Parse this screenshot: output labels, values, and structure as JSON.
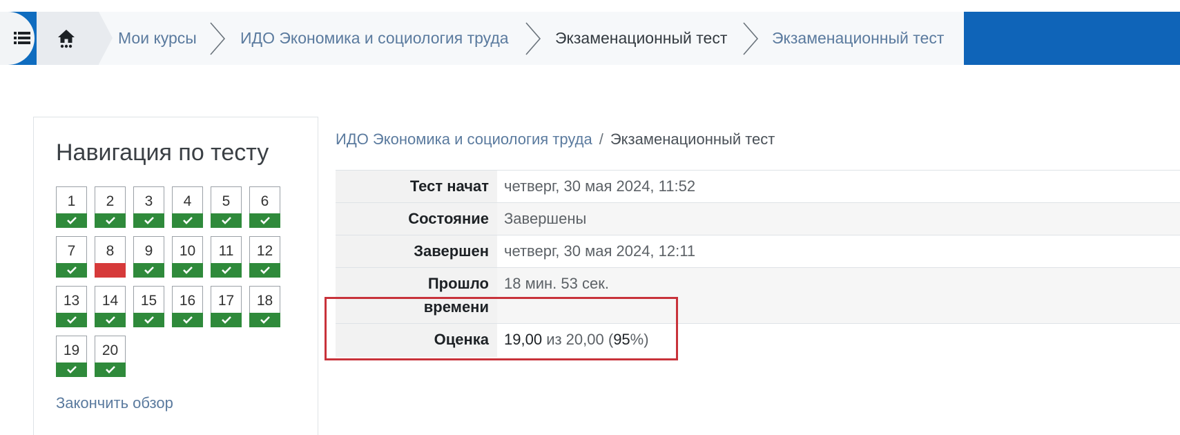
{
  "breadcrumb": {
    "items": [
      {
        "label": "Мои курсы",
        "kind": "link"
      },
      {
        "label": "ИДО Экономика и социология труда",
        "kind": "link"
      },
      {
        "label": "Экзаменационный тест",
        "kind": "current"
      },
      {
        "label": "Экзаменационный тест",
        "kind": "link"
      }
    ],
    "home_icon": "home-icon",
    "drawer_icon": "list-icon"
  },
  "colors": {
    "brand": "#0f6cbf",
    "correct": "#2f8a3b",
    "incorrect": "#d63a3a",
    "highlight": "#c8323a",
    "link": "#5a7a9e"
  },
  "quiz_nav": {
    "title": "Навигация по тесту",
    "questions": [
      {
        "number": "1",
        "state": "correct"
      },
      {
        "number": "2",
        "state": "correct"
      },
      {
        "number": "3",
        "state": "correct"
      },
      {
        "number": "4",
        "state": "correct"
      },
      {
        "number": "5",
        "state": "correct"
      },
      {
        "number": "6",
        "state": "correct"
      },
      {
        "number": "7",
        "state": "correct"
      },
      {
        "number": "8",
        "state": "incorrect"
      },
      {
        "number": "9",
        "state": "correct"
      },
      {
        "number": "10",
        "state": "correct"
      },
      {
        "number": "11",
        "state": "correct"
      },
      {
        "number": "12",
        "state": "correct"
      },
      {
        "number": "13",
        "state": "correct"
      },
      {
        "number": "14",
        "state": "correct"
      },
      {
        "number": "15",
        "state": "correct"
      },
      {
        "number": "16",
        "state": "correct"
      },
      {
        "number": "17",
        "state": "correct"
      },
      {
        "number": "18",
        "state": "correct"
      },
      {
        "number": "19",
        "state": "correct"
      },
      {
        "number": "20",
        "state": "correct"
      }
    ],
    "finish_review": "Закончить обзор"
  },
  "page_breadcrumb": {
    "course": "ИДО Экономика и социология труда",
    "separator": "/",
    "current": "Экзаменационный тест"
  },
  "summary": {
    "started_label": "Тест начат",
    "started_value": "четверг, 30 мая 2024, 11:52",
    "state_label": "Состояние",
    "state_value": "Завершены",
    "completed_label": "Завершен",
    "completed_value": "четверг, 30 мая 2024, 12:11",
    "elapsed_label_line1": "Прошло",
    "elapsed_label_line2": "времени",
    "elapsed_value": "18 мин. 53 сек.",
    "grade_label": "Оценка",
    "grade_score": "19,00",
    "grade_out_of": "из 20,00",
    "grade_percent_open": "(",
    "grade_percent": "95",
    "grade_percent_close": "%)"
  }
}
